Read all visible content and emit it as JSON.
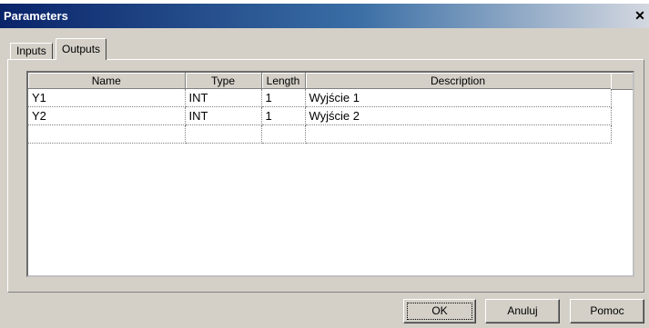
{
  "window": {
    "title": "Parameters",
    "close_glyph": "✕"
  },
  "tabs": [
    {
      "label": "Inputs",
      "selected": false
    },
    {
      "label": "Outputs",
      "selected": true
    }
  ],
  "table": {
    "columns": [
      "Name",
      "Type",
      "Length",
      "Description"
    ],
    "rows": [
      [
        "Y1",
        "INT",
        "1",
        "Wyjście 1"
      ],
      [
        "Y2",
        "INT",
        "1",
        "Wyjście 2"
      ],
      [
        "",
        "",
        "",
        ""
      ]
    ]
  },
  "buttons": {
    "ok": "OK",
    "cancel": "Anuluj",
    "help": "Pomoc"
  },
  "colors": {
    "title_bar": "#0a246a",
    "dialog_face": "#d4d0c8"
  }
}
